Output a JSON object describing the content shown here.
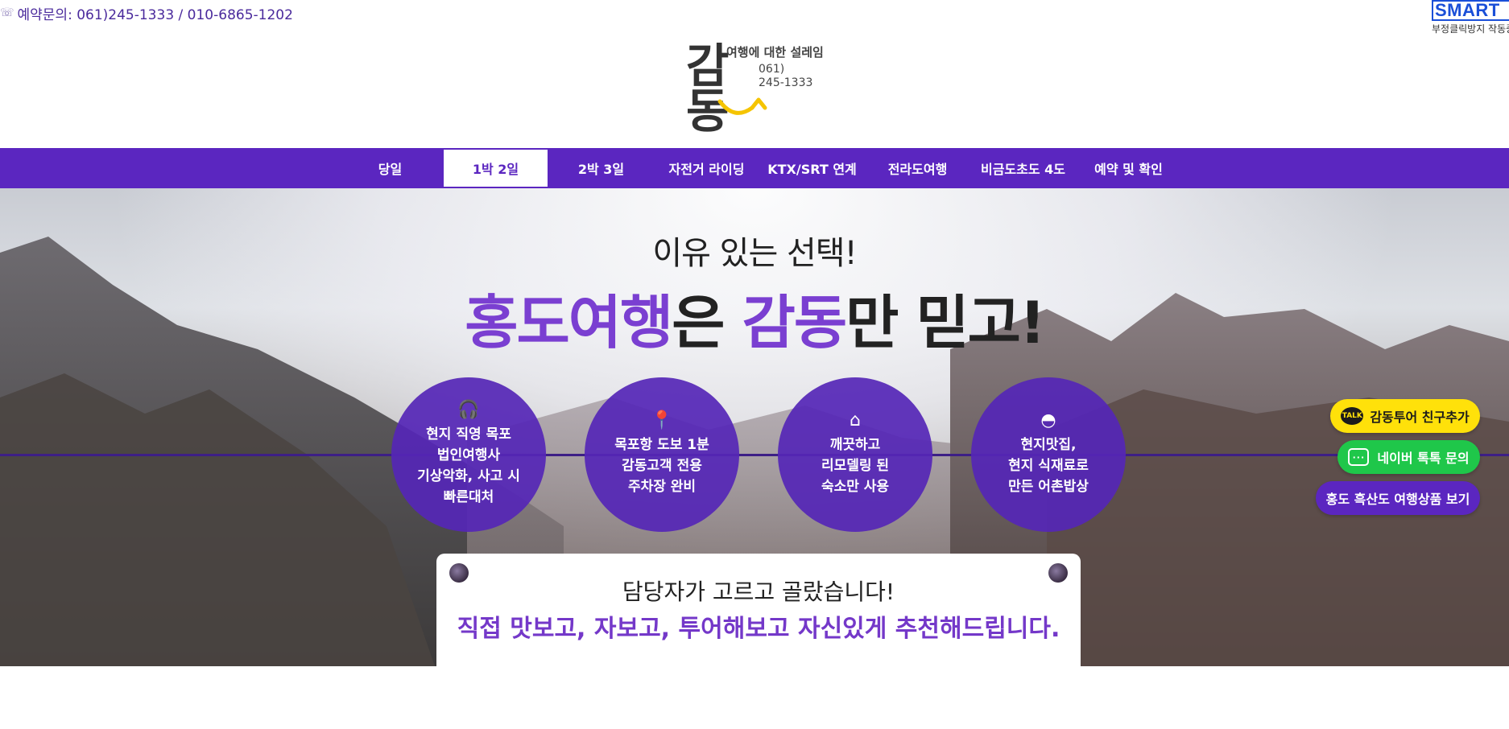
{
  "topbar": {
    "phone_icon": "☏",
    "contact_text": "예약문의: 061)245-1333 / 010-6865-1202"
  },
  "smart_badge": {
    "label": "SMART",
    "sub": "부정클릭방지 작동중"
  },
  "logo": {
    "brand_line1": "감",
    "brand_line2": "동",
    "tagline": "여행에 대한 설레임",
    "phone_line1": "061)",
    "phone_line2": "245-1333",
    "smile_color": "#f5c400"
  },
  "nav": {
    "items": [
      {
        "label": "당일"
      },
      {
        "label": "1박 2일"
      },
      {
        "label": "2박 3일"
      },
      {
        "label": "자전거 라이딩"
      },
      {
        "label": "KTX/SRT 연계"
      },
      {
        "label": "전라도여행"
      },
      {
        "label": "비금도초도 4도"
      },
      {
        "label": "예약 및 확인"
      }
    ],
    "active_index": 1,
    "color": "#5b26c0"
  },
  "hero": {
    "heading1": "이유 있는 선택!",
    "heading2_part1": "홍도여행",
    "heading2_part2": "은 ",
    "heading2_part3": "감동",
    "heading2_part4": "만 믿고!",
    "circles": [
      {
        "icon": "headset-icon",
        "glyph": "🎧",
        "lines": [
          "현지 직영 목포",
          "법인여행사",
          "기상악화, 사고 시",
          "빠른대처"
        ]
      },
      {
        "icon": "location-pin-icon",
        "glyph": "📍",
        "lines": [
          "목포항 도보 1분",
          "감동고객 전용",
          "주차장 완비"
        ]
      },
      {
        "icon": "house-icon",
        "glyph": "⌂",
        "lines": [
          "깨끗하고",
          "리모델링 된",
          "숙소만 사용"
        ]
      },
      {
        "icon": "food-cloche-icon",
        "glyph": "◓",
        "lines": [
          "현지맛집,",
          "현지 식재료로",
          "만든 어촌밥상"
        ]
      }
    ],
    "card_line1": "담당자가 고르고 골랐습니다!",
    "card_line2": "직접 맛보고, 자보고, 투어해보고 자신있게 추천해드립니다."
  },
  "floating": {
    "kakao_label": "감동투어 친구추가",
    "kakao_icon_text": "TALK",
    "naver_label": "네이버 톡톡 문의",
    "naver_icon_text": "···",
    "hongdo_label": "홍도 흑산도 여행상품 보기"
  }
}
